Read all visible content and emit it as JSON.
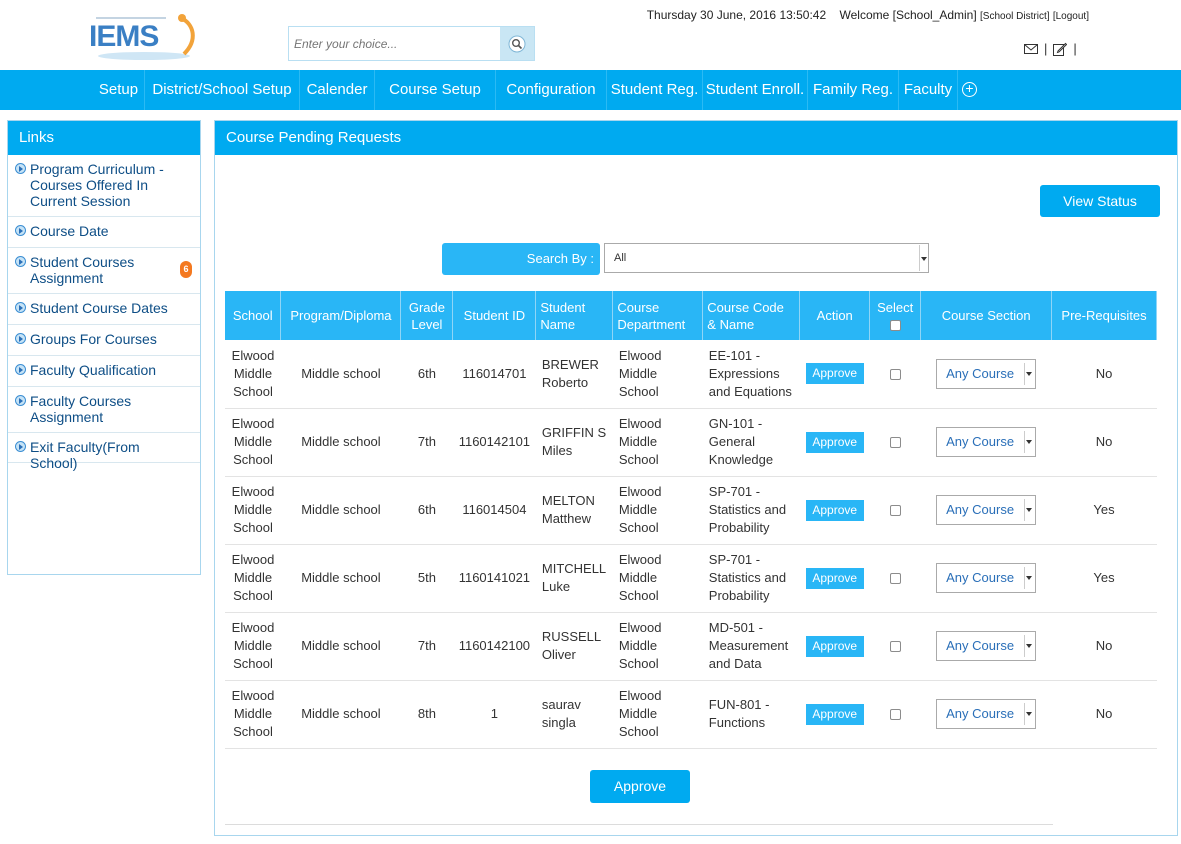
{
  "header": {
    "logo_text": "IEMS",
    "search_placeholder": "Enter your choice...",
    "datetime": "Thursday 30 June, 2016 13:50:42",
    "welcome": "Welcome [School_Admin]",
    "district": "[School District]",
    "logout": "[Logout]"
  },
  "nav": {
    "items": [
      "Setup",
      "District/School Setup",
      "Calender",
      "Course Setup",
      "Configuration",
      "Student Reg.",
      "Student Enroll.",
      "Family Reg.",
      "Faculty"
    ]
  },
  "links": {
    "title": "Links",
    "items": [
      {
        "label": "Program Curriculum - Courses Offered In Current Session"
      },
      {
        "label": "Course Date"
      },
      {
        "label": "Student Courses Assignment",
        "badge": "6"
      },
      {
        "label": "Student Course Dates"
      },
      {
        "label": "Groups For Courses"
      },
      {
        "label": "Faculty Qualification"
      },
      {
        "label": "Faculty Courses Assignment"
      },
      {
        "label": "Exit Faculty(From School)"
      }
    ]
  },
  "main": {
    "title": "Course Pending Requests",
    "view_status": "View Status",
    "search_by_label": "Search By :",
    "search_by_value": "All",
    "approve_all": "Approve",
    "columns": [
      "School",
      "Program/Diploma",
      "Grade Level",
      "Student ID",
      "Student Name",
      "Course Department",
      "Course Code & Name",
      "Action",
      "Select",
      "Course Section",
      "Pre-Requisites"
    ],
    "rows": [
      {
        "school": "Elwood Middle School",
        "program": "Middle school",
        "grade": "6th",
        "student_id": "116014701",
        "name": "BREWER Roberto",
        "dept": "Elwood Middle School",
        "course": "EE-101 - Expressions and Equations",
        "action": "Approve",
        "section": "Any Course",
        "prereq": "No"
      },
      {
        "school": "Elwood Middle School",
        "program": "Middle school",
        "grade": "7th",
        "student_id": "1160142101",
        "name": "GRIFFIN S Miles",
        "dept": "Elwood Middle School",
        "course": "GN-101 - General Knowledge",
        "action": "Approve",
        "section": "Any Course",
        "prereq": "No"
      },
      {
        "school": "Elwood Middle School",
        "program": "Middle school",
        "grade": "6th",
        "student_id": "116014504",
        "name": "MELTON Matthew",
        "dept": "Elwood Middle School",
        "course": "SP-701 - Statistics and Probability",
        "action": "Approve",
        "section": "Any Course",
        "prereq": "Yes"
      },
      {
        "school": "Elwood Middle School",
        "program": "Middle school",
        "grade": "5th",
        "student_id": "1160141021",
        "name": "MITCHELL Luke",
        "dept": "Elwood Middle School",
        "course": "SP-701 - Statistics and Probability",
        "action": "Approve",
        "section": "Any Course",
        "prereq": "Yes"
      },
      {
        "school": "Elwood Middle School",
        "program": "Middle school",
        "grade": "7th",
        "student_id": "1160142100",
        "name": "RUSSELL Oliver",
        "dept": "Elwood Middle School",
        "course": "MD-501 - Measurement and Data",
        "action": "Approve",
        "section": "Any Course",
        "prereq": "No"
      },
      {
        "school": "Elwood Middle School",
        "program": "Middle school",
        "grade": "8th",
        "student_id": "1",
        "name": "saurav singla",
        "dept": "Elwood Middle School",
        "course": "FUN-801 - Functions",
        "action": "Approve",
        "section": "Any Course",
        "prereq": "No"
      }
    ]
  },
  "colors": {
    "accent": "#00aaf0",
    "header_blue": "#29b6f6",
    "badge": "#f47920"
  }
}
